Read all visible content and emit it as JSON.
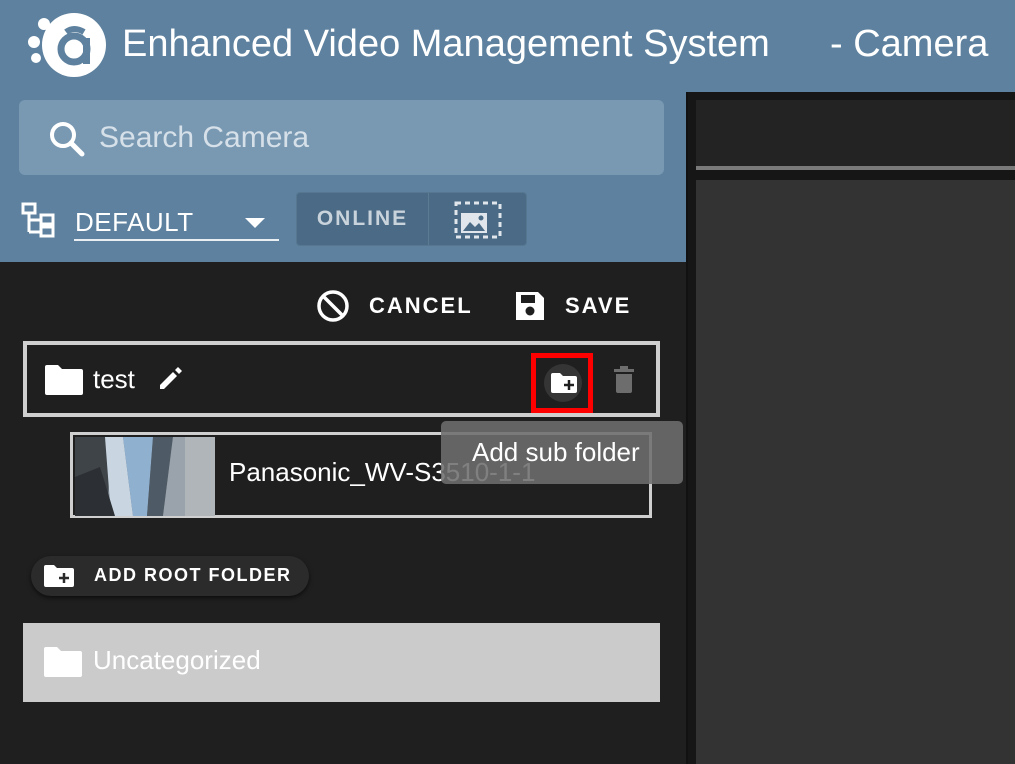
{
  "header": {
    "logo_icon": "avigilon-logo-icon",
    "title": "Enhanced Video Management System",
    "title_suffix": "- Camera"
  },
  "search": {
    "placeholder": "Search Camera",
    "icon": "search-icon"
  },
  "view_selector": {
    "icon": "site-tree-icon",
    "selected": "DEFAULT"
  },
  "toggle": {
    "online_label": "ONLINE",
    "image_icon": "image-view-icon"
  },
  "actions": {
    "cancel_label": "CANCEL",
    "save_label": "SAVE"
  },
  "folder": {
    "name": "test",
    "icons": [
      "folder-icon",
      "edit-icon",
      "add-subfolder-icon",
      "delete-icon"
    ]
  },
  "tooltip": {
    "text": "Add sub folder"
  },
  "camera": {
    "name": "Panasonic_WV-S3510-1-1"
  },
  "add_root_folder": {
    "label": "ADD ROOT FOLDER"
  },
  "uncategorized": {
    "label": "Uncategorized"
  },
  "colors": {
    "header_bg": "#5d819e",
    "panel_bg": "#1f1f1f",
    "highlight": "#ff0000",
    "row_border": "#cfcfcf"
  }
}
